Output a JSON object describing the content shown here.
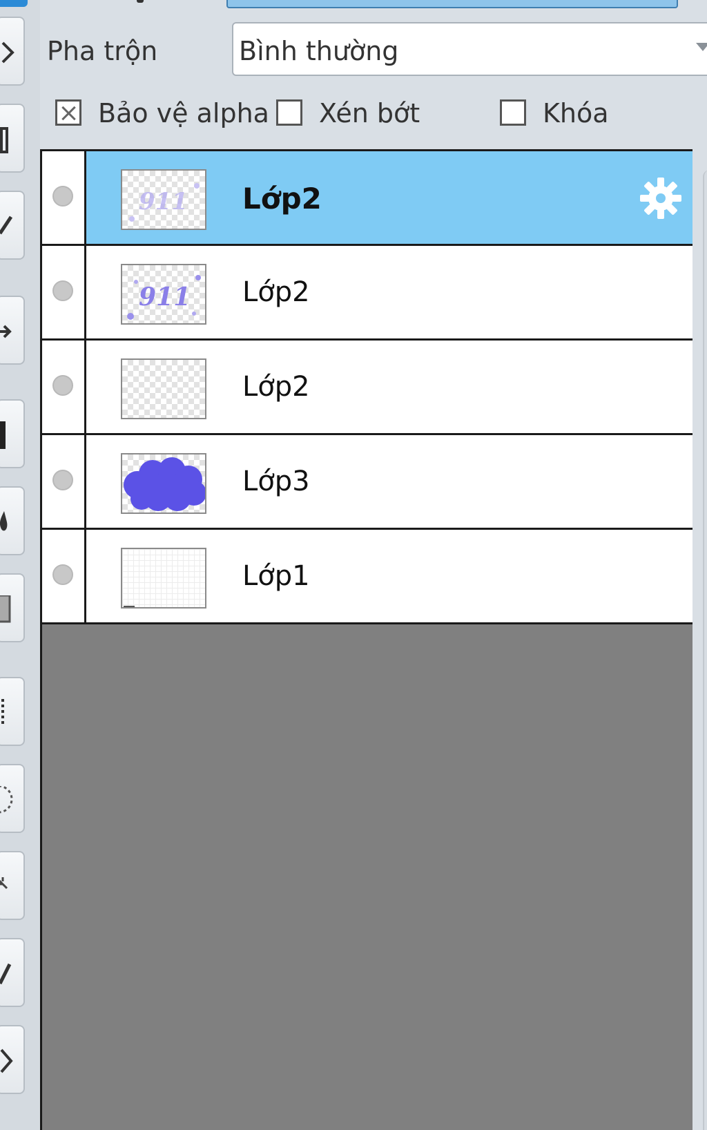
{
  "blend": {
    "label": "Pha trộn",
    "value": "Bình thường"
  },
  "options": [
    {
      "label": "Bảo vệ alpha",
      "checked": true
    },
    {
      "label": "Xén bớt",
      "checked": false
    },
    {
      "label": "Khóa",
      "checked": false
    }
  ],
  "layers": [
    {
      "name": "Lớp2",
      "selected": true,
      "thumbnail": "lettering-faint"
    },
    {
      "name": "Lớp2",
      "selected": false,
      "thumbnail": "lettering"
    },
    {
      "name": "Lớp2",
      "selected": false,
      "thumbnail": "transparent"
    },
    {
      "name": "Lớp3",
      "selected": false,
      "thumbnail": "blue-cloud"
    },
    {
      "name": "Lớp1",
      "selected": false,
      "thumbnail": "paper-grid"
    }
  ],
  "colors": {
    "selected_row": "#7fcbf4",
    "list_background": "#808080",
    "cloud": "#5b52e6",
    "lettering": "#8a7fe8"
  },
  "icons": {
    "settings": "gear-icon",
    "visibility": "visibility-dot-icon"
  }
}
